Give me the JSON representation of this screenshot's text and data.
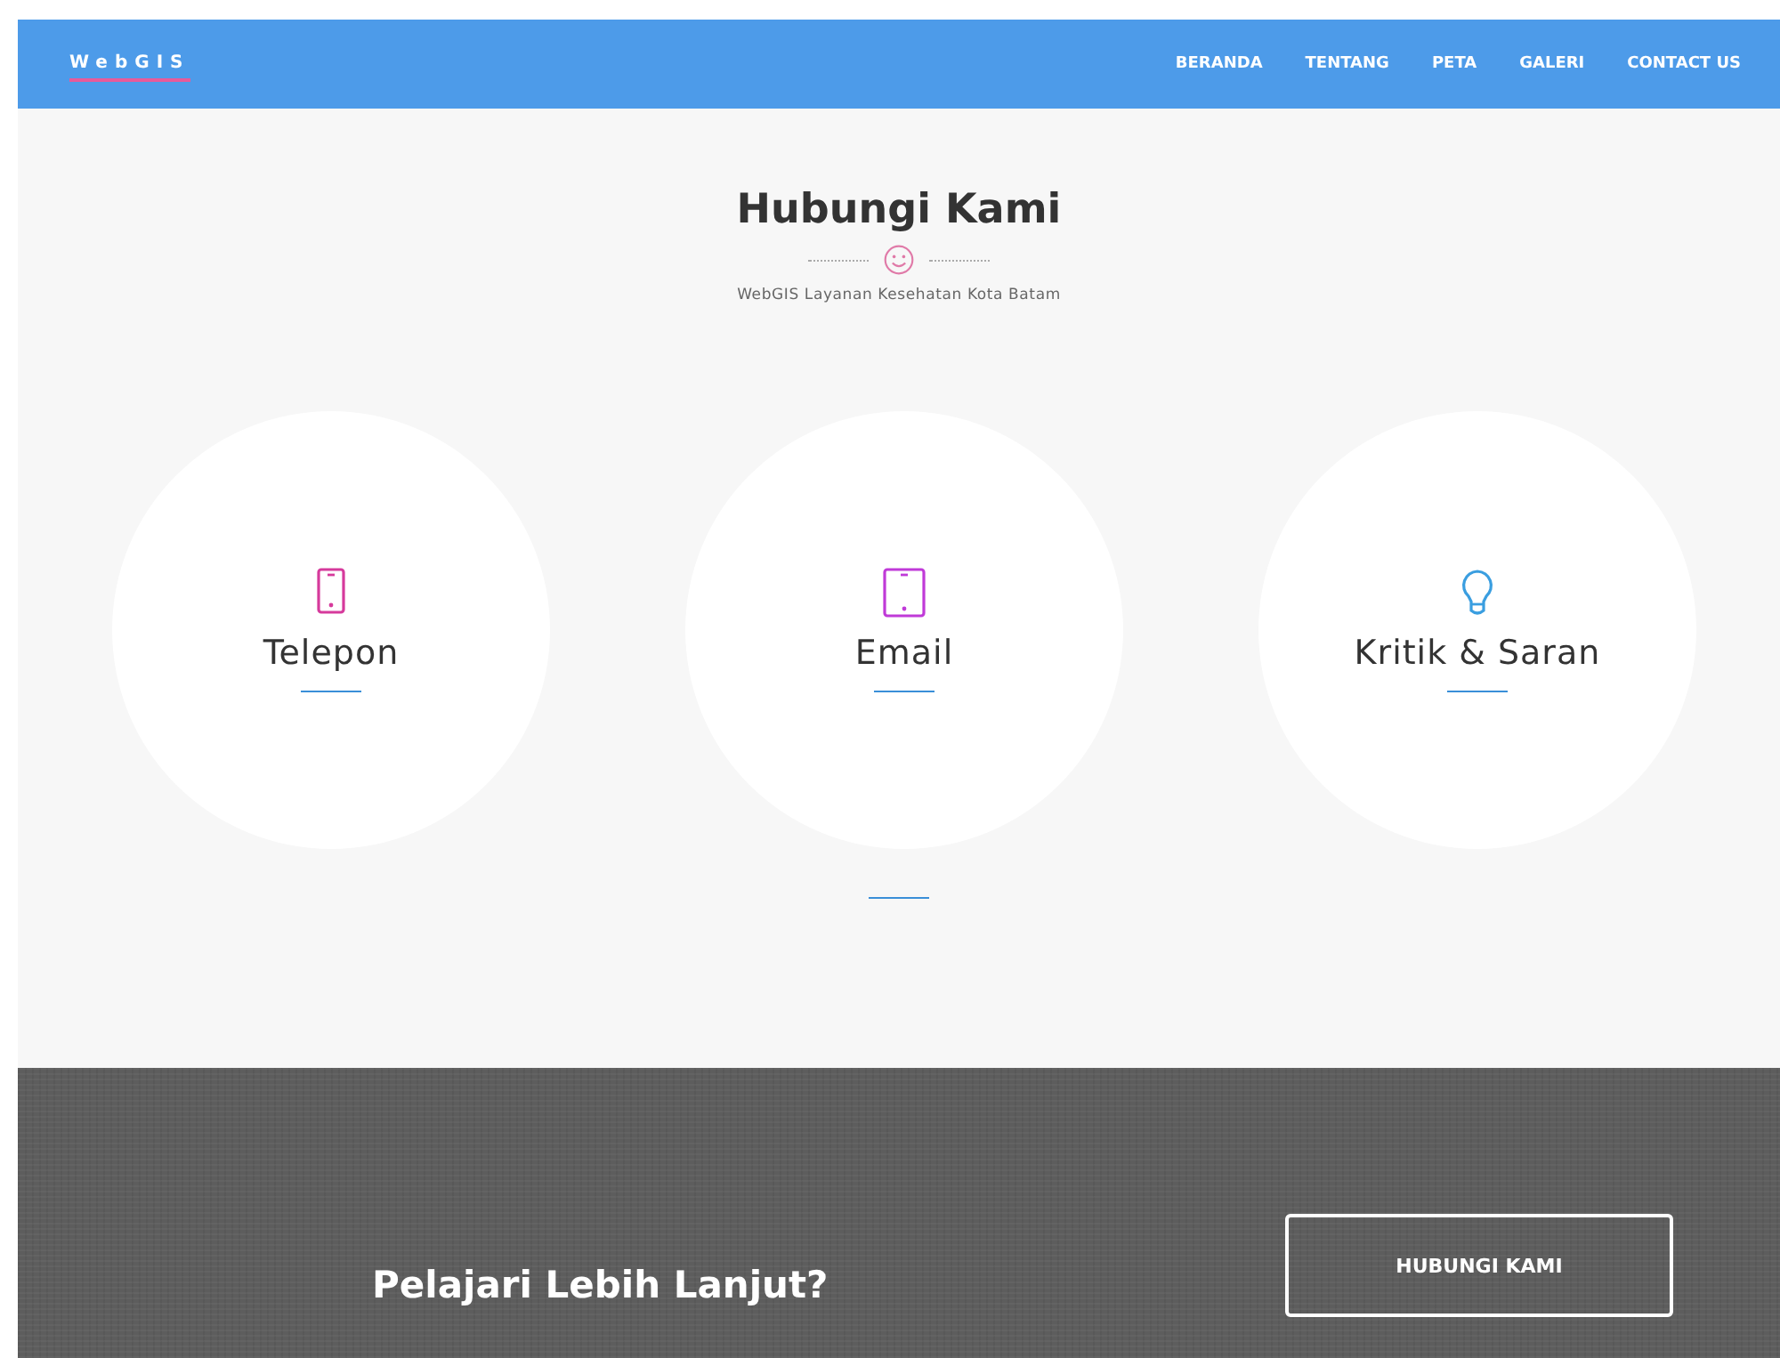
{
  "navbar": {
    "brand": "WebGIS",
    "links": [
      "BERANDA",
      "TENTANG",
      "PETA",
      "GALERI",
      "CONTACT US"
    ]
  },
  "contact": {
    "title": "Hubungi Kami",
    "subtitle": "WebGIS Layanan Kesehatan Kota Batam",
    "cards": [
      {
        "kind": "phone",
        "color": "#d63a9c",
        "label": "Telepon"
      },
      {
        "kind": "tablet",
        "color": "#c03ad8",
        "label": "Email"
      },
      {
        "kind": "bulb",
        "color": "#3a9ee0",
        "label": "Kritik & Saran"
      }
    ]
  },
  "cta": {
    "text": "Pelajari Lebih Lanjut?",
    "button": "HUBUNGI KAMI"
  }
}
